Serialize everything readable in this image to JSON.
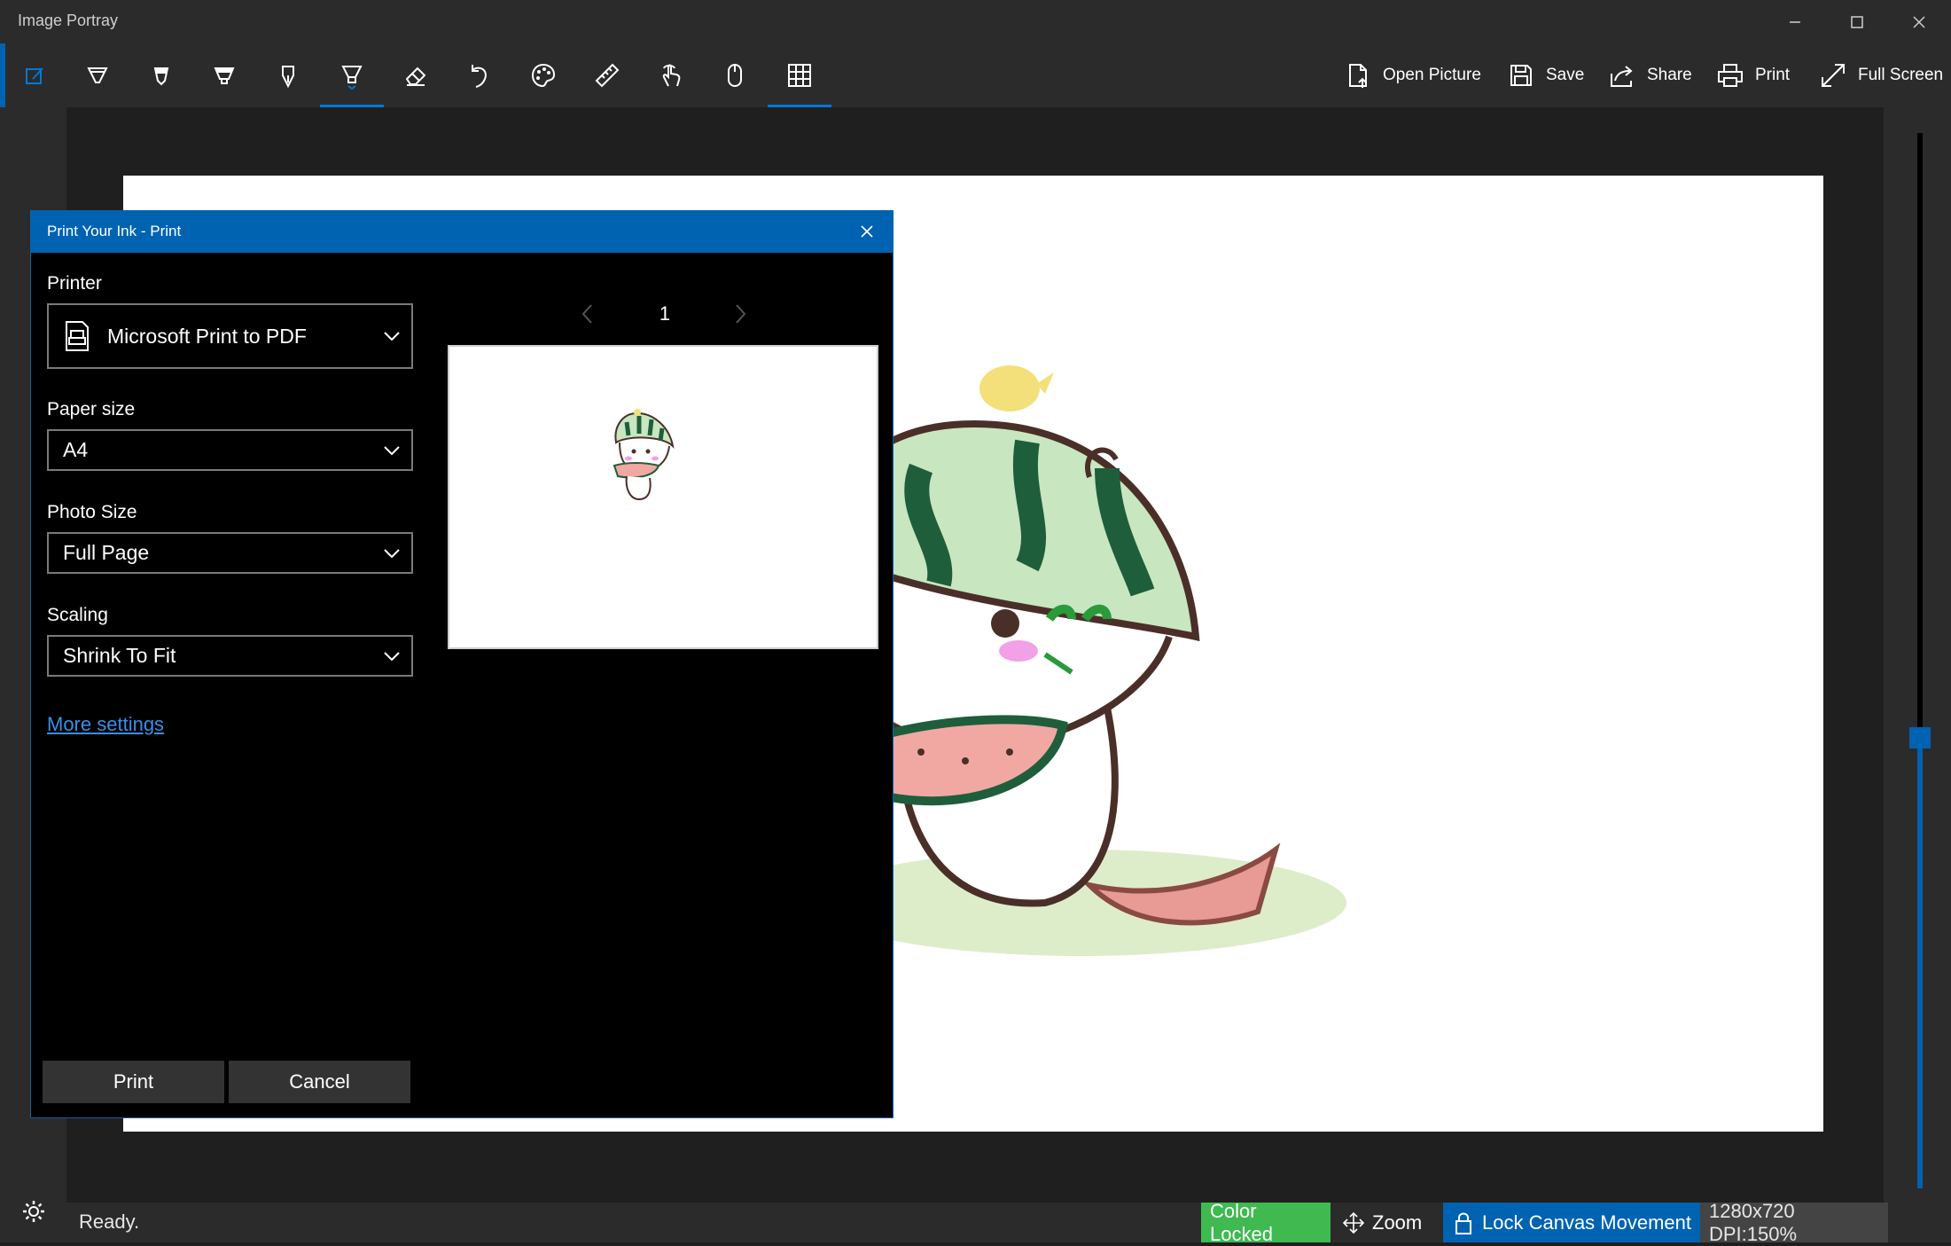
{
  "app": {
    "title": "Image Portray"
  },
  "toolbar": {
    "tools": [
      {
        "name": "edit-toggle-icon"
      },
      {
        "name": "ballpoint-pen-icon"
      },
      {
        "name": "pencil-icon"
      },
      {
        "name": "highlighter-icon"
      },
      {
        "name": "calligraphy-pen-icon"
      },
      {
        "name": "marker-pen-icon"
      },
      {
        "name": "eraser-icon"
      },
      {
        "name": "undo-icon"
      },
      {
        "name": "palette-icon"
      },
      {
        "name": "ruler-icon"
      },
      {
        "name": "touch-writing-icon"
      },
      {
        "name": "mouse-icon"
      },
      {
        "name": "grid-icon"
      }
    ],
    "commands": {
      "open_picture": "Open Picture",
      "save": "Save",
      "share": "Share",
      "print": "Print",
      "full_screen": "Full Screen"
    }
  },
  "dialog": {
    "title": "Print Your Ink - Print",
    "printer_label": "Printer",
    "printer_value": "Microsoft Print to PDF",
    "paper_size_label": "Paper size",
    "paper_size_value": "A4",
    "photo_size_label": "Photo Size",
    "photo_size_value": "Full Page",
    "scaling_label": "Scaling",
    "scaling_value": "Shrink To Fit",
    "more_settings": "More settings",
    "page_number": "1",
    "print_button": "Print",
    "cancel_button": "Cancel"
  },
  "status": {
    "text": "Ready.",
    "color_locked": "Color Locked",
    "zoom": "Zoom",
    "lock_canvas": "Lock Canvas Movement",
    "dimensions": "1280x720 DPI:150%"
  },
  "colors": {
    "accent": "#0063b1",
    "color_locked_bg": "#3fb950",
    "lock_canvas_bg": "#0063b1"
  }
}
